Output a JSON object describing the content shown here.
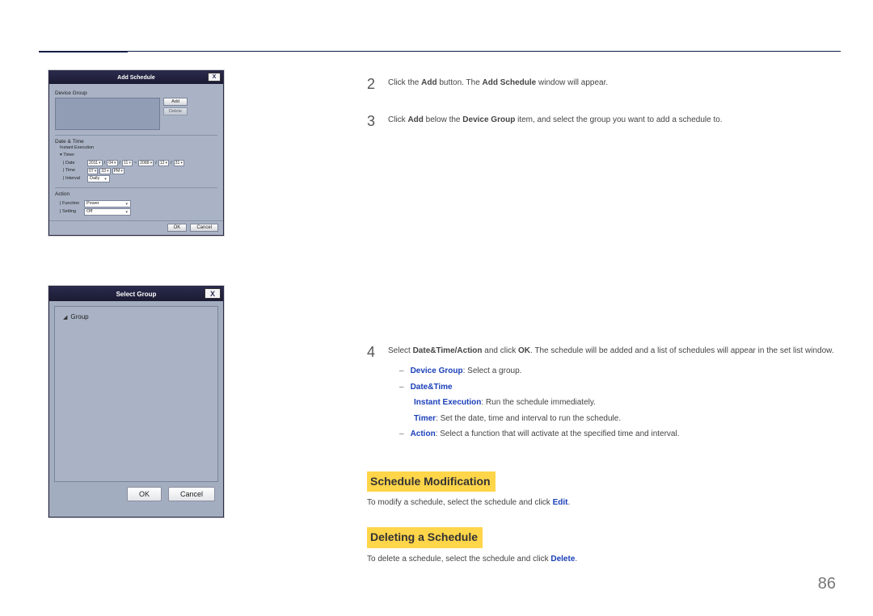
{
  "page_number": "86",
  "dialog_add": {
    "title": "Add Schedule",
    "device_group_label": "Device Group",
    "btn_add": "Add",
    "btn_delete": "Delete",
    "datetime_label": "Date & Time",
    "instant_exec": "Instant Execution",
    "timer_label": "Timer",
    "date_lbl": "Date",
    "date_y1": "2011",
    "date_m1": "04",
    "date_d1": "11",
    "date_tilde": "~",
    "date_y2": "2088",
    "date_m2": "12",
    "date_d2": "31",
    "time_lbl": "Time",
    "time_h": "07",
    "time_m": "33",
    "time_ampm": "PM",
    "interval_lbl": "Interval",
    "interval_val": "Daily",
    "action_label": "Action",
    "function_lbl": "Function",
    "function_val": "Power",
    "setting_lbl": "Setting",
    "setting_val": "Off",
    "btn_ok": "OK",
    "btn_cancel": "Cancel"
  },
  "dialog_select": {
    "title": "Select Group",
    "item_group": "Group",
    "btn_ok": "OK",
    "btn_cancel": "Cancel"
  },
  "steps": {
    "s2_num": "2",
    "s2_a": "Click the ",
    "s2_add": "Add",
    "s2_b": " button. The ",
    "s2_addsched": "Add Schedule",
    "s2_c": " window will appear.",
    "s3_num": "3",
    "s3_a": "Click ",
    "s3_add": "Add",
    "s3_b": " below the ",
    "s3_devgroup": "Device Group",
    "s3_c": " item, and select the group you want to add a schedule to.",
    "s4_num": "4",
    "s4_a": "Select ",
    "s4_dta": "Date&Time/Action",
    "s4_b": " and click ",
    "s4_ok": "OK",
    "s4_c": ". The schedule will be added and a list of schedules will appear in the set list window.",
    "sub1_label": "Device Group",
    "sub1_text": ": Select a group.",
    "sub2_label": "Date&Time",
    "sub2b_label": "Instant Execution",
    "sub2b_text": ": Run the schedule immediately.",
    "sub2c_label": "Timer",
    "sub2c_text": ": Set the date, time and interval to run the schedule.",
    "sub3_label": "Action",
    "sub3_text": ": Select a function that will activate at the specified time and interval."
  },
  "sections": {
    "mod_title": "Schedule Modification",
    "mod_text_a": "To modify a schedule, select the schedule and click ",
    "mod_edit": "Edit",
    "mod_text_b": ".",
    "del_title": "Deleting a Schedule",
    "del_text_a": "To delete a schedule, select the schedule and click ",
    "del_delete": "Delete",
    "del_text_b": "."
  }
}
